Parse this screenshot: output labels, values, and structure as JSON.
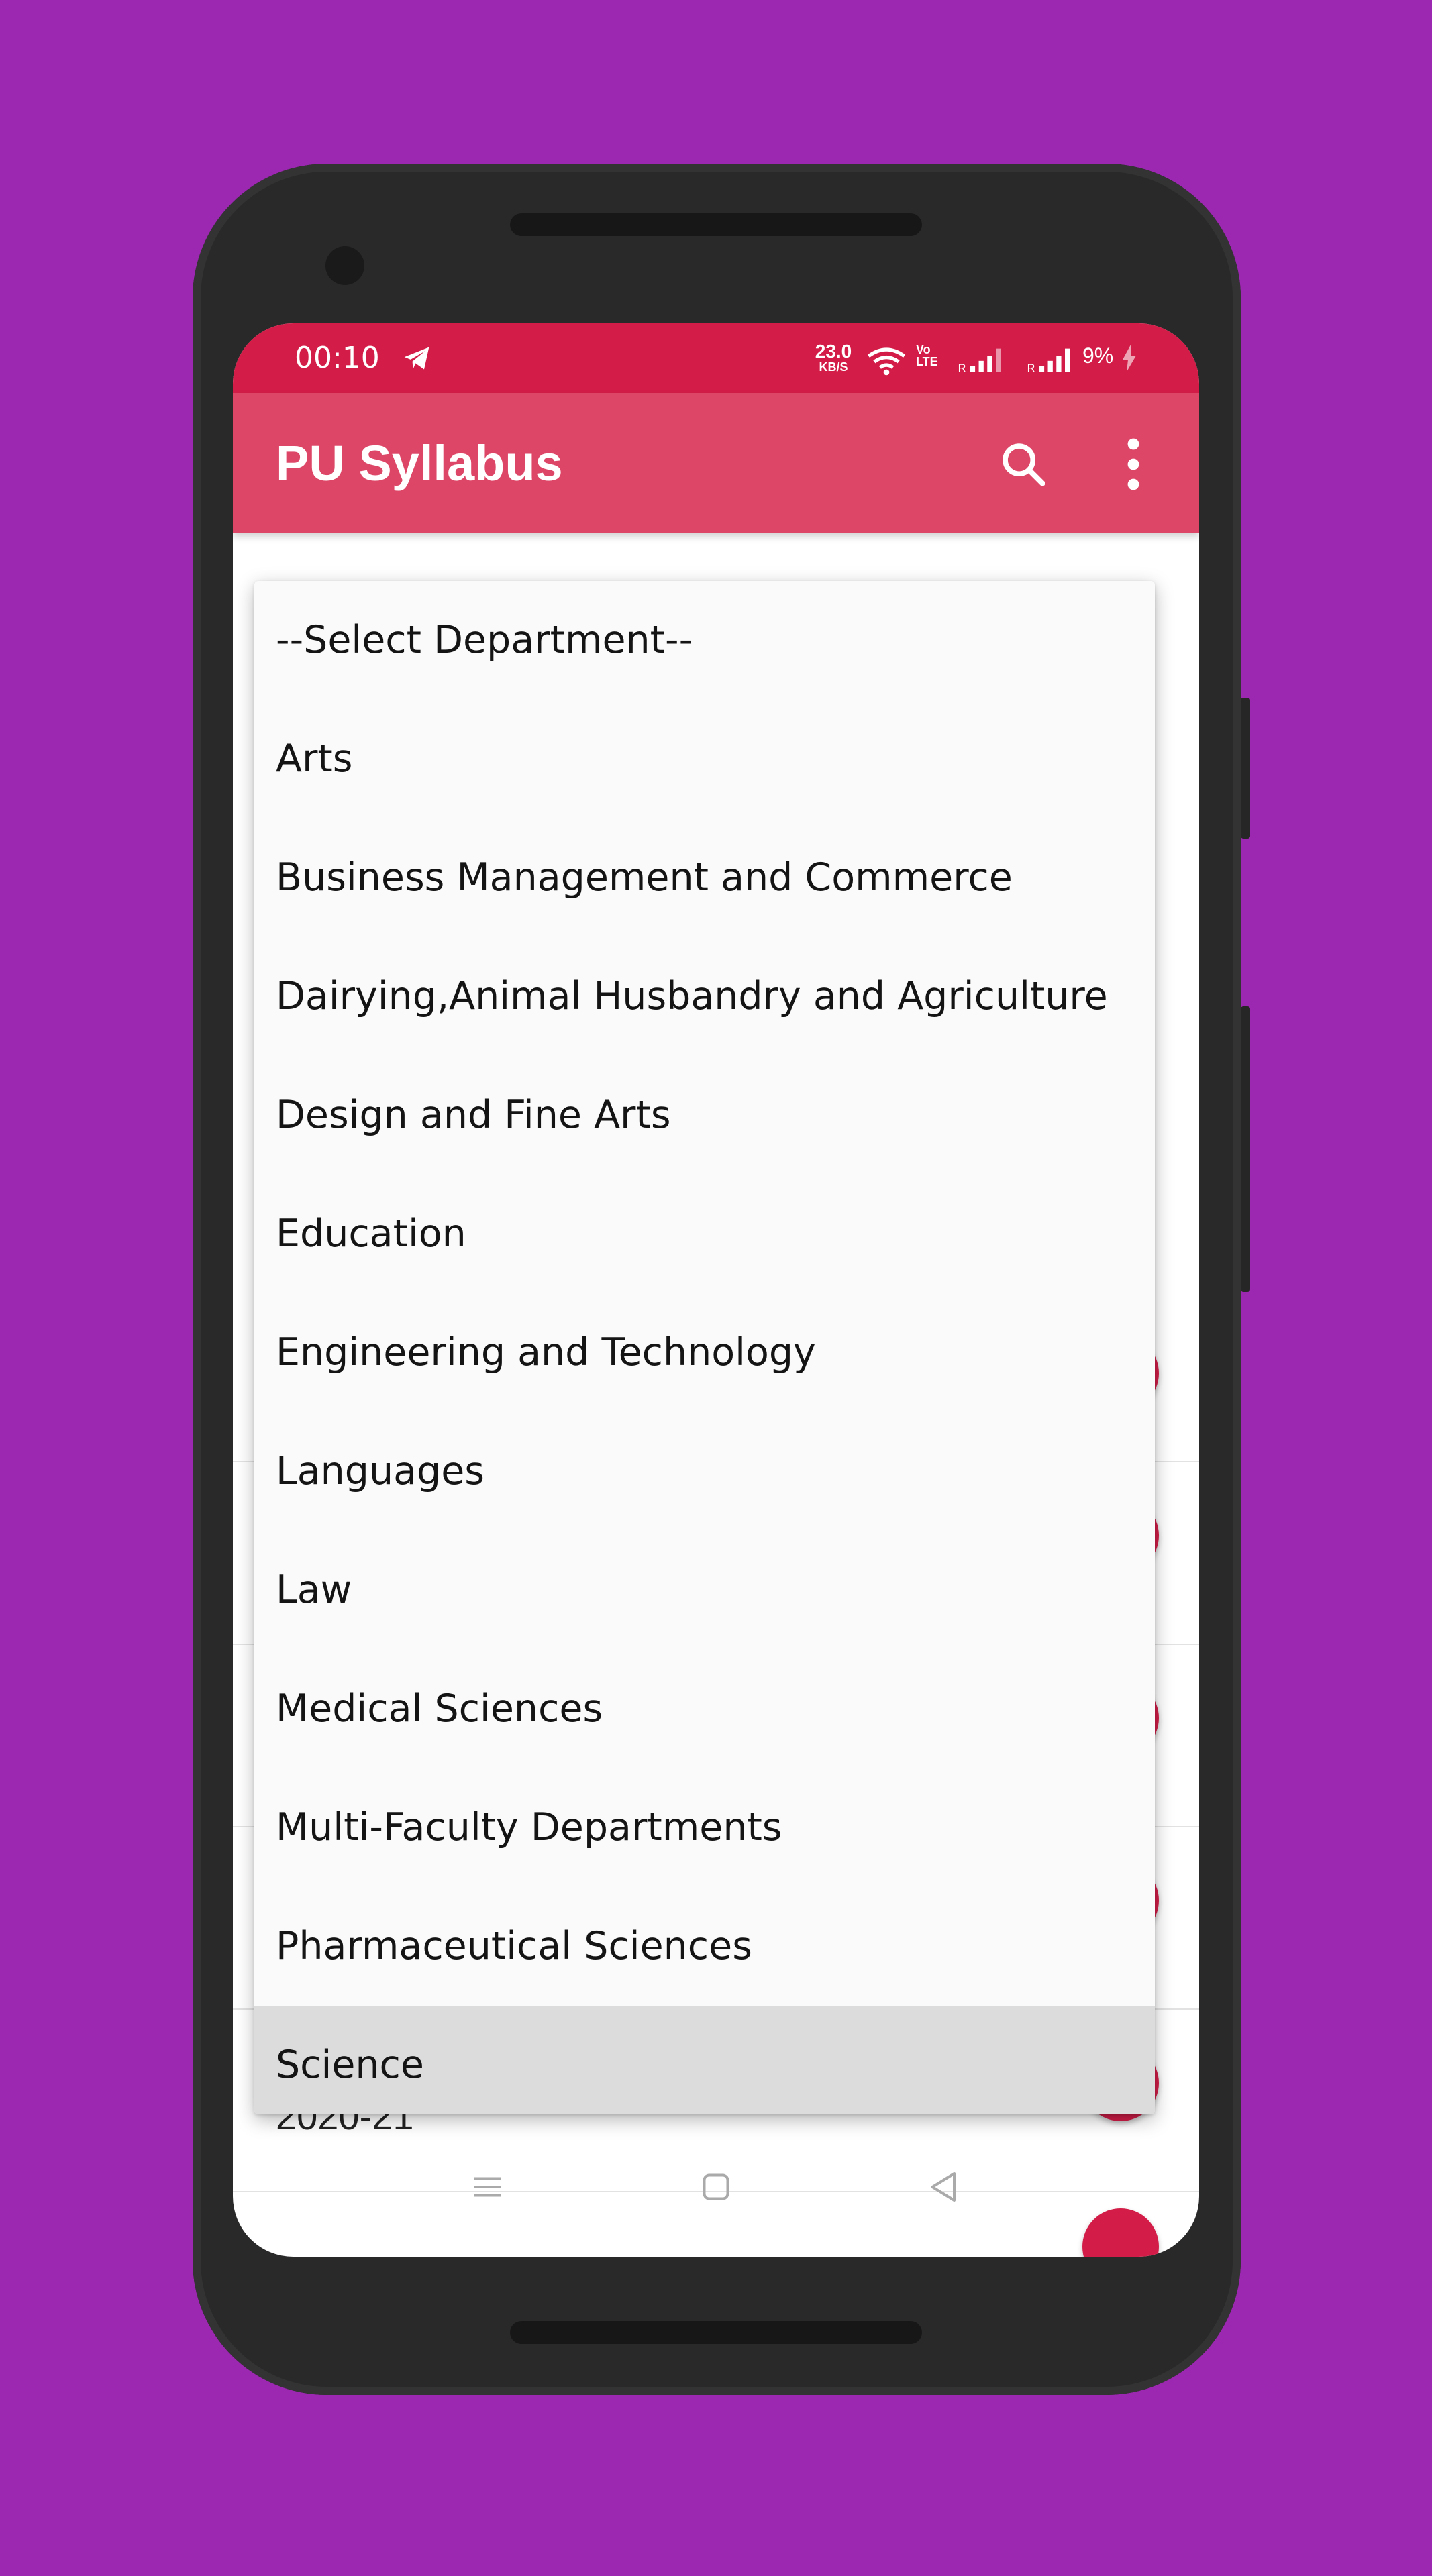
{
  "status_bar": {
    "time": "00:10",
    "network_speed_value": "23.0",
    "network_speed_unit": "KB/S",
    "volte_top": "Vo",
    "volte_bottom": "LTE",
    "sim1_label": "R",
    "sim2_label": "R",
    "battery": "9%"
  },
  "app_bar": {
    "title": "PU Syllabus"
  },
  "dropdown": {
    "items": [
      "--Select Department--",
      "Arts",
      "Business Management and Commerce",
      "Dairying,Animal Husbandry and Agriculture",
      "Design and Fine Arts",
      "Education",
      "Engineering and Technology",
      "Languages",
      "Law",
      "Medical Sciences",
      "Multi-Faculty Departments",
      "Pharmaceutical Sciences",
      "Science"
    ],
    "selected": "Science"
  },
  "background_list": {
    "last_item_text": "2020-21"
  },
  "colors": {
    "background": "#9C27B0",
    "status_bar": "#D31D48",
    "app_bar": "#DD4667",
    "accent": "#D31D48"
  }
}
